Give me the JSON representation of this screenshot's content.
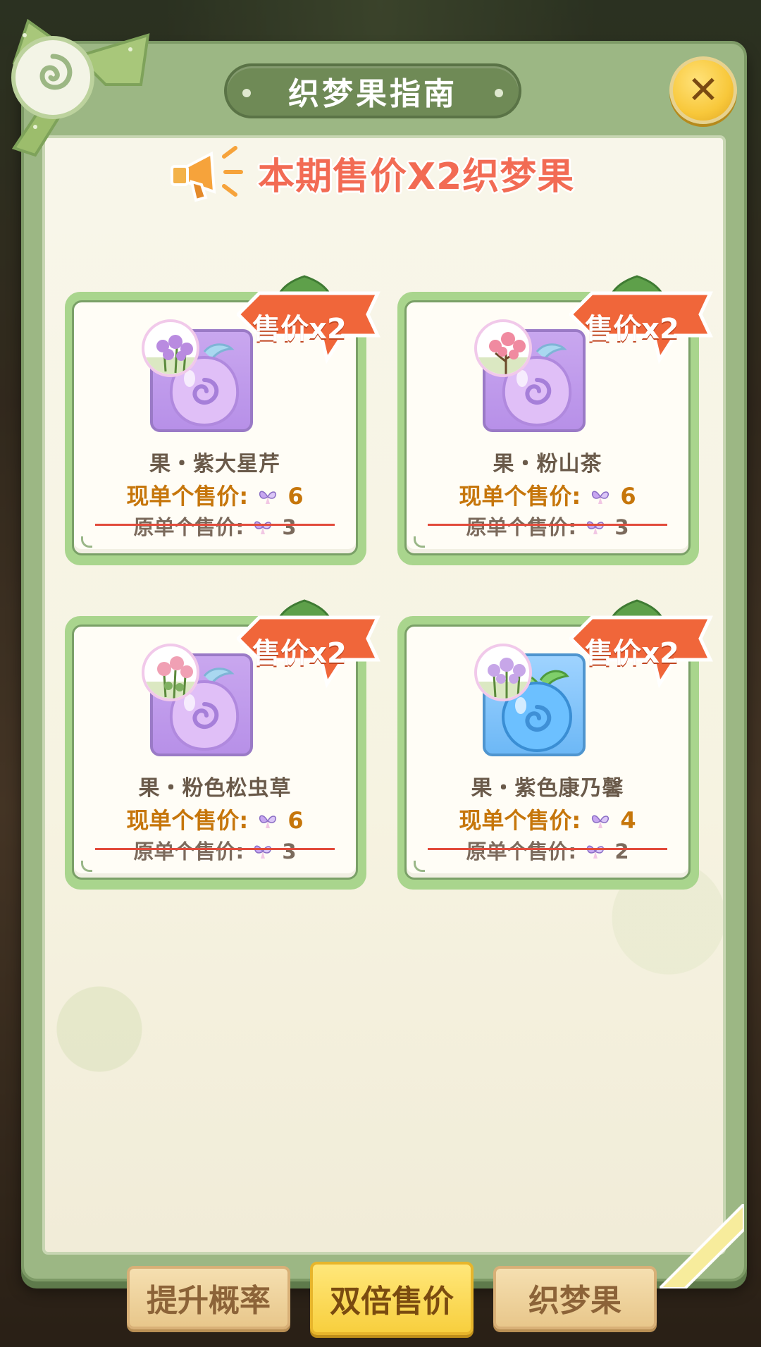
{
  "dialog": {
    "title": "织梦果指南",
    "close_icon": "close-icon",
    "banner_text": "本期售价X2织梦果"
  },
  "cards": [
    {
      "tag_label": "售价x2",
      "name": "果・紫大星芹",
      "price_now_label": "现单个售价:",
      "price_now_value": "6",
      "price_old_label": "原单个售价:",
      "price_old_value": "3",
      "fruit_color": "purple",
      "flower_color": "#b98be0"
    },
    {
      "tag_label": "售价x2",
      "name": "果・粉山茶",
      "price_now_label": "现单个售价:",
      "price_now_value": "6",
      "price_old_label": "原单个售价:",
      "price_old_value": "3",
      "fruit_color": "purple",
      "flower_color": "#f08aa0"
    },
    {
      "tag_label": "售价x2",
      "name": "果・粉色松虫草",
      "price_now_label": "现单个售价:",
      "price_now_value": "6",
      "price_old_label": "原单个售价:",
      "price_old_value": "3",
      "fruit_color": "purple",
      "flower_color": "#f0a0b4"
    },
    {
      "tag_label": "售价x2",
      "name": "果・紫色康乃馨",
      "price_now_label": "现单个售价:",
      "price_now_value": "4",
      "price_old_label": "原单个售价:",
      "price_old_value": "2",
      "fruit_color": "blue",
      "flower_color": "#c7a6e8"
    }
  ],
  "tabs": [
    {
      "label": "提升概率",
      "active": false
    },
    {
      "label": "双倍售价",
      "active": true
    },
    {
      "label": "织梦果",
      "active": false
    }
  ],
  "colors": {
    "panel_green": "#9cb784",
    "title_pill": "#6f8a56",
    "banner_text": "#f26b54",
    "price_now": "#c6760b",
    "tag_orange": "#f0663a",
    "tab_active": "#f8cf3e"
  }
}
